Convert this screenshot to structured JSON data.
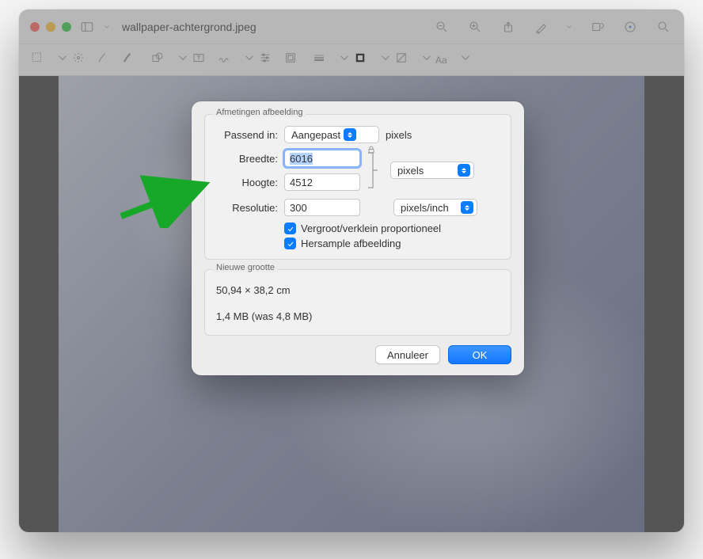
{
  "window": {
    "title": "wallpaper-achtergrond.jpeg"
  },
  "dialog": {
    "group_dimensions_title": "Afmetingen afbeelding",
    "fit_label": "Passend in:",
    "fit_value": "Aangepast",
    "fit_unit": "pixels",
    "width_label": "Breedte:",
    "width_value": "6016",
    "height_label": "Hoogte:",
    "height_value": "4512",
    "dim_unit": "pixels",
    "resolution_label": "Resolutie:",
    "resolution_value": "300",
    "resolution_unit": "pixels/inch",
    "scale_proportional_label": "Vergroot/verklein proportioneel",
    "resample_label": "Hersample afbeelding",
    "group_size_title": "Nieuwe grootte",
    "size_cm": "50,94 × 38,2 cm",
    "size_mb": "1,4 MB (was 4,8 MB)",
    "cancel_label": "Annuleer",
    "ok_label": "OK"
  },
  "toolbar2": {
    "font_label": "Aa"
  }
}
